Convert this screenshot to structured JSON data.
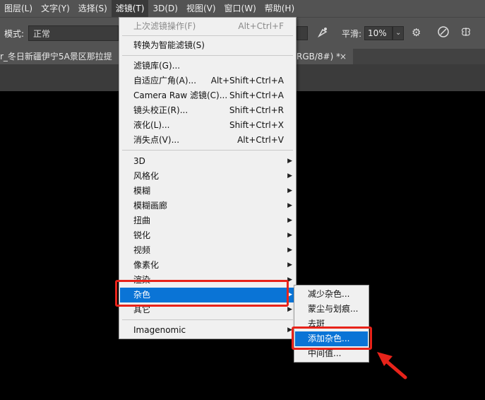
{
  "menubar": {
    "items": [
      "图层(L)",
      "文字(Y)",
      "选择(S)",
      "滤镜(T)",
      "3D(D)",
      "视图(V)",
      "窗口(W)",
      "帮助(H)"
    ],
    "active_index": 3
  },
  "options": {
    "mode_label": "模式:",
    "mode_value": "正常",
    "smooth_label": "平滑:",
    "smooth_value": "10%"
  },
  "document_tab": {
    "title": "r_冬日新疆伊宁5A景区那拉提",
    "suffix": "RGB/8#) *",
    "close": "×"
  },
  "filter_menu": {
    "last_filter": {
      "label": "上次滤镜操作(F)",
      "shortcut": "Alt+Ctrl+F"
    },
    "smart_filter": "转换为智能滤镜(S)",
    "gallery": {
      "label": "滤镜库(G)...",
      "shortcut": ""
    },
    "adaptive_wide": {
      "label": "自适应广角(A)...",
      "shortcut": "Alt+Shift+Ctrl+A"
    },
    "camera_raw": {
      "label": "Camera Raw 滤镜(C)...",
      "shortcut": "Shift+Ctrl+A"
    },
    "lens_correction": {
      "label": "镜头校正(R)...",
      "shortcut": "Shift+Ctrl+R"
    },
    "liquify": {
      "label": "液化(L)...",
      "shortcut": "Shift+Ctrl+X"
    },
    "vanishing_point": {
      "label": "消失点(V)...",
      "shortcut": "Alt+Ctrl+V"
    },
    "categories": [
      "3D",
      "风格化",
      "模糊",
      "模糊画廊",
      "扭曲",
      "锐化",
      "视频",
      "像素化",
      "渲染",
      "杂色",
      "其它"
    ],
    "highlighted_category": "杂色",
    "plugin": "Imagenomic"
  },
  "noise_submenu": {
    "items": [
      "减少杂色...",
      "蒙尘与划痕...",
      "去斑",
      "添加杂色...",
      "中间值..."
    ],
    "highlighted": "添加杂色..."
  },
  "annotation_colors": {
    "highlight_box": "#e8231a",
    "menu_highlight": "#0a74d6"
  }
}
